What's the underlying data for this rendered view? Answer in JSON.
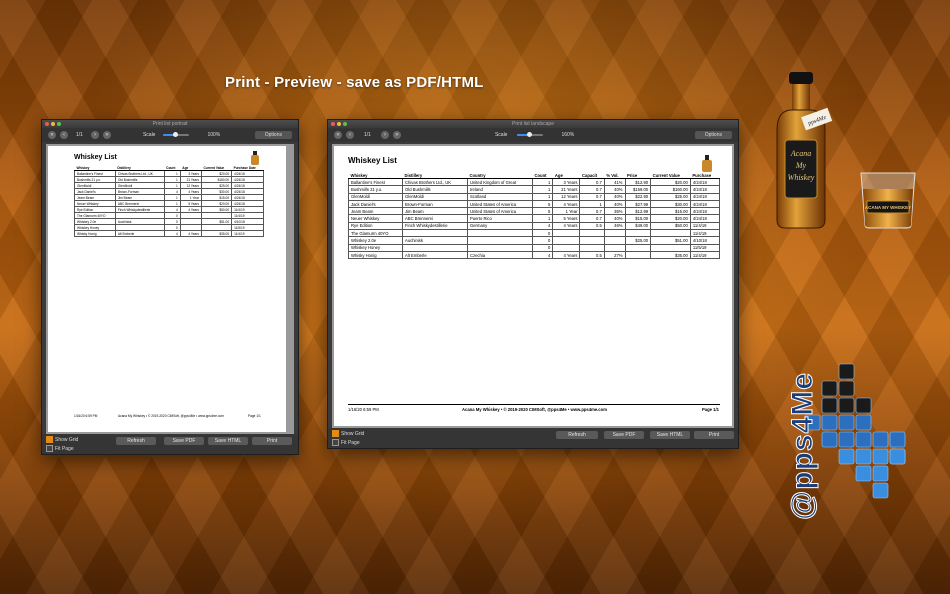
{
  "headline": "Print - Preview - save as PDF/HTML",
  "portrait": {
    "title": "Print list portrait",
    "page_indicator": "1/1",
    "scale_label": "Scale",
    "zoom": "100%",
    "zoom_fraction": 0.45,
    "options_label": "Options",
    "show_grid_label": "Show Grid",
    "show_grid_checked": true,
    "fit_page_label": "Fit Page",
    "fit_page_checked": false,
    "buttons": {
      "refresh": "Refresh",
      "save_pdf": "Save PDF",
      "save_html": "Save HTML",
      "print": "Print"
    },
    "doc": {
      "title": "Whiskey List",
      "columns": [
        "Whiskey",
        "Distillery",
        "Count",
        "Age",
        "Current Value",
        "Purchase Date"
      ],
      "rows": [
        [
          "Ballantine's Finest",
          "Chivas Brothers Ltd., UK",
          "1",
          "3 Years",
          "$20.00",
          "4/24/18"
        ],
        [
          "Bushmills 21 y.o.",
          "Old Bushmills",
          "1",
          "21 Years",
          "$160.00",
          "4/24/18"
        ],
        [
          "GlenMoldi",
          "GlenMoldi",
          "1",
          "12 Years",
          "$25.00",
          "4/24/18"
        ],
        [
          "Jack Daniel's",
          "Brown-Forman",
          "4",
          "4 Years",
          "$30.00",
          "4/24/18"
        ],
        [
          "Jeam Beam",
          "Jim Beam",
          "1",
          "1 Year",
          "$15.00",
          "4/24/18"
        ],
        [
          "Neuer Whiskey",
          "ABC Brennerei",
          "1",
          "5 Years",
          "$20.00",
          "4/24/18"
        ],
        [
          "Rye Edition",
          "Finch Whiskydestillerie",
          "4",
          "4 Years",
          "$50.00",
          "11/4/19"
        ],
        [
          "The Glamurm 40YO",
          "",
          "0",
          "",
          "",
          "11/4/19"
        ],
        [
          "Whiskey 2.0e",
          "Auchinisk",
          "0",
          "",
          "$51.00",
          "4/10/18"
        ],
        [
          "Whiskey Honey",
          "",
          "0",
          "",
          "",
          "11/5/19"
        ],
        [
          "Whisky Honig",
          "Alt Emberle",
          "4",
          "4 Years",
          "$35.00",
          "11/4/19"
        ]
      ],
      "footer_left": "1/16/20 6:59 PM",
      "footer_center": "Acana My Whiskey • © 2019-2020 CIMSoft, @pps4Me • www.pps4me.com",
      "footer_right": "Page 1/1"
    }
  },
  "landscape": {
    "title": "Print list landscape",
    "page_indicator": "1/1",
    "scale_label": "Scale",
    "zoom": "160%",
    "zoom_fraction": 0.45,
    "options_label": "Options",
    "show_grid_label": "Show Grid",
    "show_grid_checked": true,
    "fit_page_label": "Fit Page",
    "fit_page_checked": false,
    "buttons": {
      "refresh": "Refresh",
      "save_pdf": "Save PDF",
      "save_html": "Save HTML",
      "print": "Print"
    },
    "doc": {
      "title": "Whiskey List",
      "columns": [
        "Whiskey",
        "Distillery",
        "Country",
        "Count",
        "Age",
        "Capacit",
        "% Vol.",
        "Price",
        "Current Value",
        "Purchase"
      ],
      "rows": [
        [
          "Ballantine's Finest",
          "Chivas Brothers Ltd., UK",
          "United Kingdom of Great",
          "1",
          "3 Years",
          "0.7",
          "41%",
          "$12.90",
          "$20.00",
          "4/24/18"
        ],
        [
          "Bushmills 21 y.o.",
          "Old Bushmills",
          "Ireland",
          "1",
          "21 Years",
          "0.7",
          "40%",
          "$159.00",
          "$160.00",
          "4/24/18"
        ],
        [
          "GlenMoldi",
          "GlenMoldi",
          "Scotland",
          "1",
          "12 Years",
          "0.7",
          "40%",
          "$22.90",
          "$25.00",
          "4/24/18"
        ],
        [
          "Jack Daniel's",
          "Brown-Forman",
          "United States of America",
          "5",
          "4 Years",
          "1",
          "40%",
          "$27.99",
          "$30.00",
          "4/24/18"
        ],
        [
          "Jeam Beam",
          "Jim Beam",
          "United States of America",
          "5",
          "1 Year",
          "0.7",
          "35%",
          "$12.99",
          "$15.00",
          "4/24/18"
        ],
        [
          "Neuer Whiskey",
          "ABC Brennerei",
          "Puerto Rico",
          "1",
          "5 Years",
          "0.7",
          "40%",
          "$15.00",
          "$20.00",
          "4/24/18"
        ],
        [
          "Rye Edition",
          "Finch Whiskydestillerie",
          "Germany",
          "4",
          "4 Years",
          "0.5",
          "46%",
          "$49.00",
          "$50.00",
          "11/4/19"
        ],
        [
          "The Glamurm 40YO",
          "",
          "",
          "0",
          "",
          "",
          "",
          "",
          "",
          "11/4/19"
        ],
        [
          "Whiskey 2.0e",
          "Auchinisk",
          "",
          "0",
          "",
          "",
          "",
          "$25.00",
          "$51.00",
          "4/10/18"
        ],
        [
          "Whiskey Honey",
          "",
          "",
          "0",
          "",
          "",
          "",
          "",
          "",
          "11/5/19"
        ],
        [
          "Whisky Honig",
          "Alt Emberle",
          "Czechia",
          "4",
          "4 Years",
          "0.5",
          "27%",
          "",
          "$35.00",
          "11/4/19"
        ]
      ],
      "footer_left": "1/16/20 6:59 PM",
      "footer_center": "Acana My Whiskey • © 2019-2020 CIMSoft, @pps4Me • www.pps4me.com",
      "footer_right": "Page 1/1"
    }
  },
  "bottle": {
    "label_line1": "Acana",
    "label_line2": "My",
    "label_line3": "Whiskey",
    "tag": "pps4Me"
  },
  "glass": {
    "label": "ACANA MY WHISKEY"
  },
  "logo": {
    "text": "@pps4Me"
  },
  "colors": {
    "accent": "#e38b14",
    "background": "#b65d0c",
    "window": "#3a3a3a"
  },
  "icons": [
    "skip-first-icon",
    "prev-icon",
    "next-icon",
    "skip-last-icon",
    "whiskey-bottle-icon"
  ]
}
